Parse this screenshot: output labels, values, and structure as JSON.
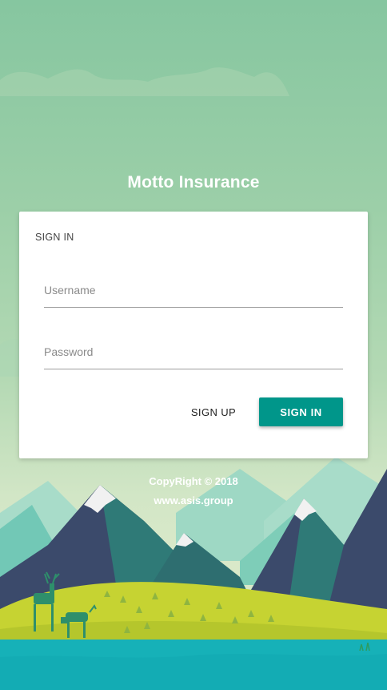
{
  "app": {
    "title": "Motto Insurance"
  },
  "login_card": {
    "heading": "SIGN IN",
    "username_placeholder": "Username",
    "password_placeholder": "Password",
    "signup_label": "SIGN UP",
    "signin_label": "SIGN IN"
  },
  "footer": {
    "copyright": "CopyRight © 2018",
    "website": "www.asis.group"
  },
  "colors": {
    "primary": "#00968a",
    "sky_top": "#86c6a0",
    "meadow": "#c6d332",
    "water": "#16b1b8",
    "mountain_dark": "#3b4a6b"
  },
  "icons": {
    "background": "mountain-landscape-illustration"
  }
}
